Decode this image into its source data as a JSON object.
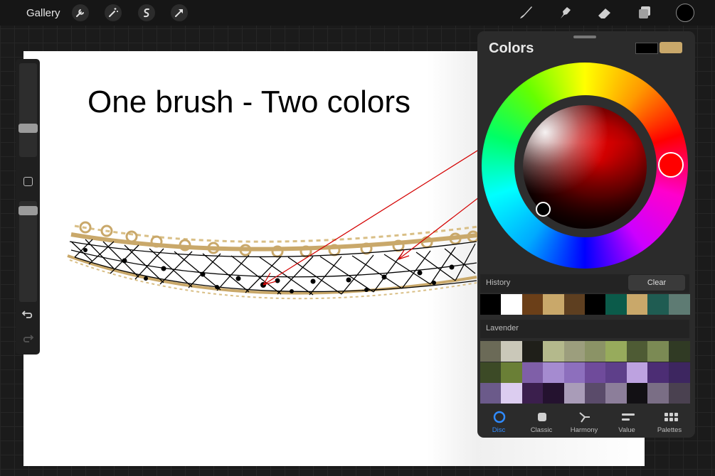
{
  "topbar": {
    "gallery_label": "Gallery",
    "left_tools": [
      "wrench-icon",
      "magic-wand-icon",
      "selection-icon",
      "transform-icon"
    ],
    "right_tools": [
      "brush-icon",
      "smudge-icon",
      "eraser-icon",
      "layers-icon"
    ],
    "current_color": "#000000"
  },
  "canvas": {
    "title": "One brush - Two colors"
  },
  "colors_panel": {
    "title": "Colors",
    "primary_color": "#000000",
    "secondary_color": "#c9a86a",
    "hue": "#ff0000",
    "history": {
      "label": "History",
      "clear_label": "Clear",
      "swatches": [
        "#000000",
        "#ffffff",
        "#6b3f18",
        "#c9a86a",
        "#5e3f20",
        "#000000",
        "#0b5b4a",
        "#c9a86a",
        "#1f5c52",
        "#5e7b73"
      ]
    },
    "palette": {
      "label": "Lavender",
      "rows": [
        [
          "#6b6a57",
          "#cac8b9",
          "#1f1f19",
          "#b4b98c",
          "#9c9e7d",
          "#8b9366",
          "#97ab5c",
          "#4e5b34",
          "#7b8a54",
          "#303a24"
        ],
        [
          "#3c4a26",
          "#6a7f36",
          "#7f5fa8",
          "#a58bd0",
          "#8d6fbd",
          "#6f4b9b",
          "#5e3f8a",
          "#bda2e0",
          "#4c2d74",
          "#3d2660"
        ],
        [
          "#6b5a8a",
          "#dccdf0",
          "#3b1f4d",
          "#24122f",
          "#a99cb8",
          "#5a4b6a",
          "#8c7e9a",
          "#121014",
          "#7a6e85",
          "#4a4150"
        ]
      ]
    },
    "tabs": [
      {
        "label": "Disc",
        "icon": "disc-icon",
        "active": true
      },
      {
        "label": "Classic",
        "icon": "classic-icon",
        "active": false
      },
      {
        "label": "Harmony",
        "icon": "harmony-icon",
        "active": false
      },
      {
        "label": "Value",
        "icon": "value-icon",
        "active": false
      },
      {
        "label": "Palettes",
        "icon": "palettes-icon",
        "active": false
      }
    ]
  }
}
